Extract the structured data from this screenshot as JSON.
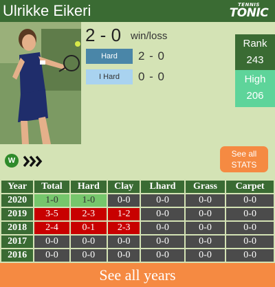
{
  "header": {
    "player_name": "Ulrikke Eikeri",
    "logo_small": "TENNIS",
    "logo_big": "TONIC"
  },
  "summary": {
    "wins": "2",
    "losses": "0",
    "score": "2 - 0",
    "label": "win/loss"
  },
  "surfaces": [
    {
      "name": "Hard",
      "score": "2 - 0",
      "color": "#4a86a8"
    },
    {
      "name": "I Hard",
      "score": "0 - 0",
      "color": "#a9d3f0"
    }
  ],
  "ranking": {
    "rank_label": "Rank",
    "rank_value": "243",
    "high_label": "High",
    "high_value": "206"
  },
  "buttons": {
    "see_all_stats_line1": "See all",
    "see_all_stats_line2": "STATS",
    "see_all_years": "See all years"
  },
  "form": {
    "w_label": "W",
    "icon": "triple-chevron-right-icon"
  },
  "table": {
    "columns": [
      "Year",
      "Total",
      "Hard",
      "Clay",
      "Lhard",
      "Grass",
      "Carpet"
    ],
    "rows": [
      {
        "year": "2020",
        "cells": [
          "1-0",
          "1-0",
          "0-0",
          "0-0",
          "0-0",
          "0-0"
        ],
        "status": [
          "win",
          "win",
          "none",
          "none",
          "none",
          "none"
        ]
      },
      {
        "year": "2019",
        "cells": [
          "3-5",
          "2-3",
          "1-2",
          "0-0",
          "0-0",
          "0-0"
        ],
        "status": [
          "loss",
          "loss",
          "loss",
          "none",
          "none",
          "none"
        ]
      },
      {
        "year": "2018",
        "cells": [
          "2-4",
          "0-1",
          "2-3",
          "0-0",
          "0-0",
          "0-0"
        ],
        "status": [
          "loss",
          "loss",
          "loss",
          "none",
          "none",
          "none"
        ]
      },
      {
        "year": "2017",
        "cells": [
          "0-0",
          "0-0",
          "0-0",
          "0-0",
          "0-0",
          "0-0"
        ],
        "status": [
          "none",
          "none",
          "none",
          "none",
          "none",
          "none"
        ]
      },
      {
        "year": "2016",
        "cells": [
          "0-0",
          "0-0",
          "0-0",
          "0-0",
          "0-0",
          "0-0"
        ],
        "status": [
          "none",
          "none",
          "none",
          "none",
          "none",
          "none"
        ]
      }
    ]
  },
  "colors": {
    "header_green": "#3a6b33",
    "background": "#d4e3b5",
    "win": "#76c66c",
    "loss": "#c80000",
    "neutral": "#4b4b4b",
    "accent_orange": "#f58a42",
    "high_green": "#5ed49a"
  }
}
